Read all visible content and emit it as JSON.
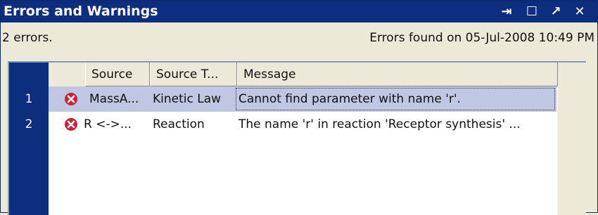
{
  "window": {
    "title": "Errors and Warnings",
    "buttons": {
      "pin": "⇥",
      "maximize": "☐",
      "undock": "↗",
      "close": "✕"
    }
  },
  "status": {
    "count_text": "2 errors.",
    "found_text": "Errors found on 05-Jul-2008 10:49 PM"
  },
  "table": {
    "columns": [
      "Source",
      "Source T...",
      "Message"
    ],
    "rows": [
      {
        "number": "1",
        "source": "MassA...",
        "source_type": "Kinetic Law",
        "message": "Cannot find parameter with name 'r'.",
        "selected": true
      },
      {
        "number": "2",
        "source": "R <->...",
        "source_type": "Reaction",
        "message": "The name 'r' in reaction 'Receptor synthesis' ...",
        "selected": false
      }
    ]
  },
  "colors": {
    "title_bar": "#0d2e7f",
    "row_header": "#0d2e7f",
    "selection": "#bfc7e3",
    "error_icon": "#cc2233"
  },
  "icons": {
    "error": "error-icon"
  }
}
